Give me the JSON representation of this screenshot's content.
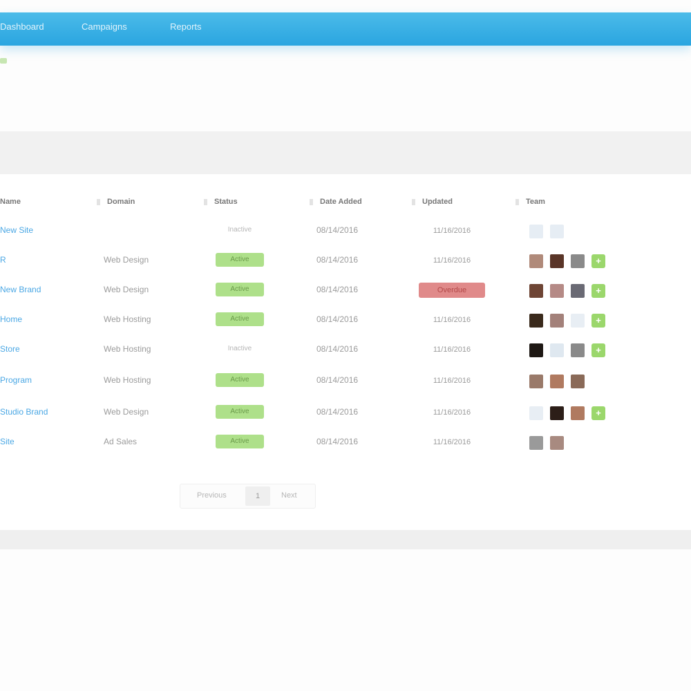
{
  "nav": {
    "items": [
      "Dashboard",
      "Campaigns",
      "Reports"
    ]
  },
  "table": {
    "columns": [
      "Name",
      "Domain",
      "Status",
      "Date Added",
      "Updated",
      "Team"
    ],
    "rows": [
      {
        "name": "New Site",
        "domain": "",
        "status": "Inactive",
        "status_style": "grey",
        "date_added": "08/14/2016",
        "updated": "11/16/2016",
        "updated_style": "plain",
        "team": [
          "#e6edf4",
          "#e6edf4"
        ],
        "plus": false
      },
      {
        "name": "R",
        "domain": "Web Design",
        "status": "Active",
        "status_style": "green",
        "date_added": "08/14/2016",
        "updated": "11/16/2016",
        "updated_style": "plain",
        "team": [
          "#b08a7a",
          "#5a3528",
          "#8a8a8a"
        ],
        "plus": true
      },
      {
        "name": "New Brand",
        "domain": "Web Design",
        "status": "Active",
        "status_style": "green",
        "date_added": "08/14/2016",
        "updated": "Overdue",
        "updated_style": "red",
        "team": [
          "#6e4535",
          "#b58a86",
          "#6a6a74"
        ],
        "plus": true
      },
      {
        "name": "Home",
        "domain": "Web Hosting",
        "status": "Active",
        "status_style": "green",
        "date_added": "08/14/2016",
        "updated": "11/16/2016",
        "updated_style": "plain",
        "team": [
          "#3a2a1c",
          "#a3817a",
          "#e8eef4"
        ],
        "plus": true
      },
      {
        "name": "Store",
        "domain": "Web Hosting",
        "status": "Inactive",
        "status_style": "grey",
        "date_added": "08/14/2016",
        "updated": "11/16/2016",
        "updated_style": "plain",
        "team": [
          "#1e1814",
          "#dfe8f0",
          "#8a8a8a"
        ],
        "plus": true
      },
      {
        "name": "Program",
        "domain": "Web Hosting",
        "status": "Active",
        "status_style": "green",
        "date_added": "08/14/2016",
        "updated": "11/16/2016",
        "updated_style": "plain",
        "team": [
          "#9a7a6a",
          "#b07a60",
          "#8a6a58"
        ],
        "plus": false
      },
      {
        "name": "Studio Brand",
        "domain": "Web Design",
        "status": "Active",
        "status_style": "green",
        "date_added": "08/14/2016",
        "updated": "11/16/2016",
        "updated_style": "plain",
        "team": [
          "#e8eef4",
          "#2c1e18",
          "#b07a60"
        ],
        "plus": true
      },
      {
        "name": "Site",
        "domain": "Ad Sales",
        "status": "Active",
        "status_style": "green",
        "date_added": "08/14/2016",
        "updated": "11/16/2016",
        "updated_style": "plain",
        "team": [
          "#9a9a9a",
          "#a88a80"
        ],
        "plus": false
      }
    ]
  },
  "pager": {
    "prev": "Previous",
    "current": "1",
    "next": "Next"
  }
}
